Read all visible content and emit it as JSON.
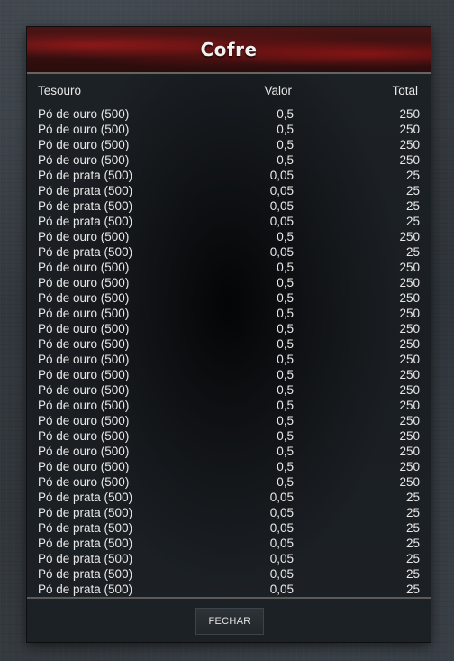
{
  "window": {
    "title": "Cofre"
  },
  "table": {
    "columns": [
      "Tesouro",
      "Valor",
      "Total"
    ],
    "rows": [
      {
        "name": "Pó de ouro (500)",
        "valor": "0,5",
        "total": "250"
      },
      {
        "name": "Pó de ouro (500)",
        "valor": "0,5",
        "total": "250"
      },
      {
        "name": "Pó de ouro (500)",
        "valor": "0,5",
        "total": "250"
      },
      {
        "name": "Pó de ouro (500)",
        "valor": "0,5",
        "total": "250"
      },
      {
        "name": "Pó de prata (500)",
        "valor": "0,05",
        "total": "25"
      },
      {
        "name": "Pó de prata (500)",
        "valor": "0,05",
        "total": "25"
      },
      {
        "name": "Pó de prata (500)",
        "valor": "0,05",
        "total": "25"
      },
      {
        "name": "Pó de prata (500)",
        "valor": "0,05",
        "total": "25"
      },
      {
        "name": "Pó de ouro (500)",
        "valor": "0,5",
        "total": "250"
      },
      {
        "name": "Pó de prata (500)",
        "valor": "0,05",
        "total": "25"
      },
      {
        "name": "Pó de ouro (500)",
        "valor": "0,5",
        "total": "250"
      },
      {
        "name": "Pó de ouro (500)",
        "valor": "0,5",
        "total": "250"
      },
      {
        "name": "Pó de ouro (500)",
        "valor": "0,5",
        "total": "250"
      },
      {
        "name": "Pó de ouro (500)",
        "valor": "0,5",
        "total": "250"
      },
      {
        "name": "Pó de ouro (500)",
        "valor": "0,5",
        "total": "250"
      },
      {
        "name": "Pó de ouro (500)",
        "valor": "0,5",
        "total": "250"
      },
      {
        "name": "Pó de ouro (500)",
        "valor": "0,5",
        "total": "250"
      },
      {
        "name": "Pó de ouro (500)",
        "valor": "0,5",
        "total": "250"
      },
      {
        "name": "Pó de ouro (500)",
        "valor": "0,5",
        "total": "250"
      },
      {
        "name": "Pó de ouro (500)",
        "valor": "0,5",
        "total": "250"
      },
      {
        "name": "Pó de ouro (500)",
        "valor": "0,5",
        "total": "250"
      },
      {
        "name": "Pó de ouro (500)",
        "valor": "0,5",
        "total": "250"
      },
      {
        "name": "Pó de ouro (500)",
        "valor": "0,5",
        "total": "250"
      },
      {
        "name": "Pó de ouro (500)",
        "valor": "0,5",
        "total": "250"
      },
      {
        "name": "Pó de ouro (500)",
        "valor": "0,5",
        "total": "250"
      },
      {
        "name": "Pó de prata (500)",
        "valor": "0,05",
        "total": "25"
      },
      {
        "name": "Pó de prata (500)",
        "valor": "0,05",
        "total": "25"
      },
      {
        "name": "Pó de prata (500)",
        "valor": "0,05",
        "total": "25"
      },
      {
        "name": "Pó de prata (500)",
        "valor": "0,05",
        "total": "25"
      },
      {
        "name": "Pó de prata (500)",
        "valor": "0,05",
        "total": "25"
      },
      {
        "name": "Pó de prata (500)",
        "valor": "0,05",
        "total": "25"
      },
      {
        "name": "Pó de prata (500)",
        "valor": "0,05",
        "total": "25"
      }
    ]
  },
  "footer": {
    "close_label": "FECHAR"
  },
  "colors": {
    "title_accent": "#b01c1c",
    "panel_bg": "#1c2126",
    "text": "#e8e8e8"
  }
}
